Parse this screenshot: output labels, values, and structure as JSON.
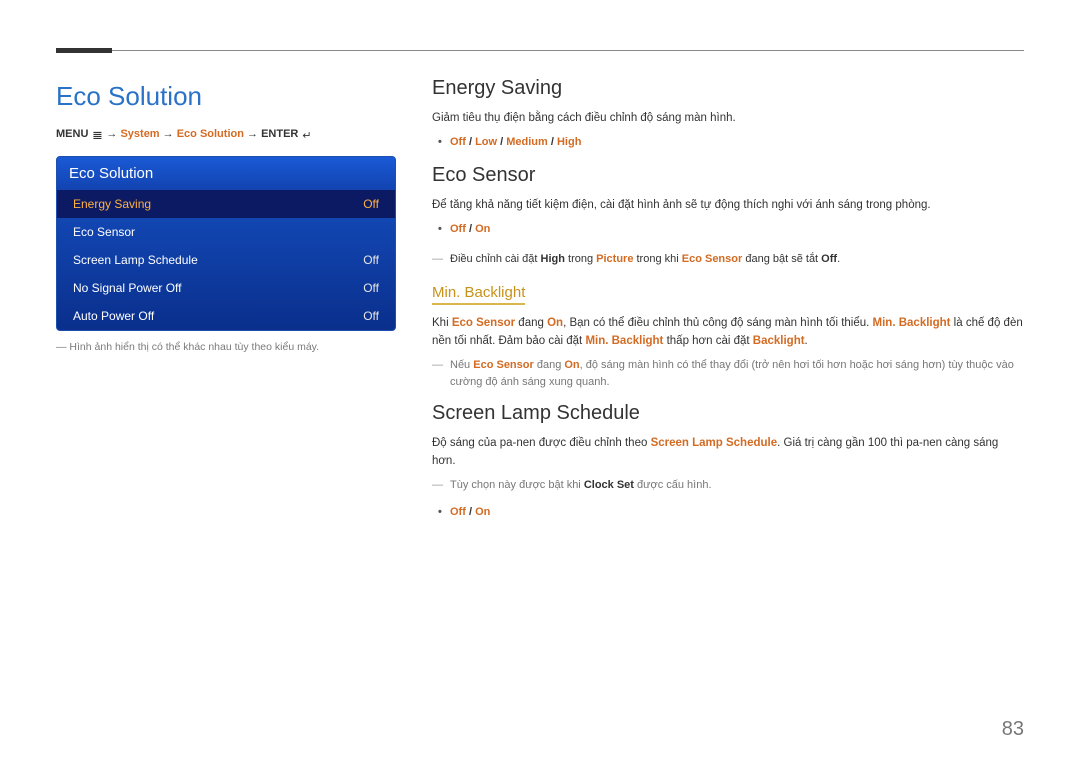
{
  "page": {
    "title": "Eco Solution",
    "number": "83",
    "footnote": "Hình ảnh hiển thị có thể khác nhau tùy theo kiểu máy."
  },
  "breadcrumb": {
    "menu": "MENU",
    "arrow": "→",
    "system": "System",
    "eco": "Eco Solution",
    "enter": "ENTER"
  },
  "osd": {
    "title": "Eco Solution",
    "rows": [
      {
        "label": "Energy Saving",
        "value": "Off",
        "selected": true
      },
      {
        "label": "Eco Sensor",
        "value": ""
      },
      {
        "label": "Screen Lamp Schedule",
        "value": "Off"
      },
      {
        "label": "No Signal Power Off",
        "value": "Off"
      },
      {
        "label": "Auto Power Off",
        "value": "Off"
      }
    ]
  },
  "sections": {
    "energy": {
      "heading": "Energy Saving",
      "desc": "Giảm tiêu thụ điện bằng cách điều chỉnh độ sáng màn hình.",
      "opts": [
        "Off",
        "Low",
        "Medium",
        "High"
      ]
    },
    "ecosensor": {
      "heading": "Eco Sensor",
      "desc": "Để tăng khả năng tiết kiệm điện, cài đặt hình ảnh sẽ tự động thích nghi với ánh sáng trong phòng.",
      "opts": [
        "Off",
        "On"
      ],
      "note1_pre": "Điều chỉnh cài đặt ",
      "note1_high": "High",
      "note1_mid1": " trong ",
      "note1_picture": "Picture",
      "note1_mid2": " trong khi ",
      "note1_eco": "Eco Sensor",
      "note1_mid3": " đang bật sẽ tắt ",
      "note1_off": "Off",
      "note1_end": "."
    },
    "minbl": {
      "heading": "Min. Backlight",
      "p1_pre": "Khi ",
      "p1_eco": "Eco Sensor",
      "p1_mid1": " đang ",
      "p1_on": "On",
      "p1_mid2": ", Bạn có thể điều chỉnh thủ công độ sáng màn hình tối thiểu. ",
      "p1_mb": "Min. Backlight",
      "p1_mid3": " là chế độ đèn nền tối nhất. Đảm bảo cài đặt ",
      "p1_mb2": "Min. Backlight",
      "p1_mid4": " thấp hơn cài đặt ",
      "p1_bl": "Backlight",
      "p1_end": ".",
      "note_pre": "Nếu ",
      "note_eco": "Eco Sensor",
      "note_mid1": " đang ",
      "note_on": "On",
      "note_mid2": ", độ sáng màn hình có thể thay đổi (trở nên hơi tối hơn hoặc hơi sáng hơn) tùy thuộc vào cường độ ánh sáng xung quanh."
    },
    "lamp": {
      "heading": "Screen Lamp Schedule",
      "p1_pre": "Độ sáng của pa-nen được điều chỉnh theo ",
      "p1_hl": "Screen Lamp Schedule",
      "p1_post": ". Giá trị càng gần 100 thì pa-nen càng sáng hơn.",
      "note_pre": "Tùy chọn này được bật khi ",
      "note_clock": "Clock Set",
      "note_post": " được cấu hình.",
      "opts": [
        "Off",
        "On"
      ]
    }
  }
}
